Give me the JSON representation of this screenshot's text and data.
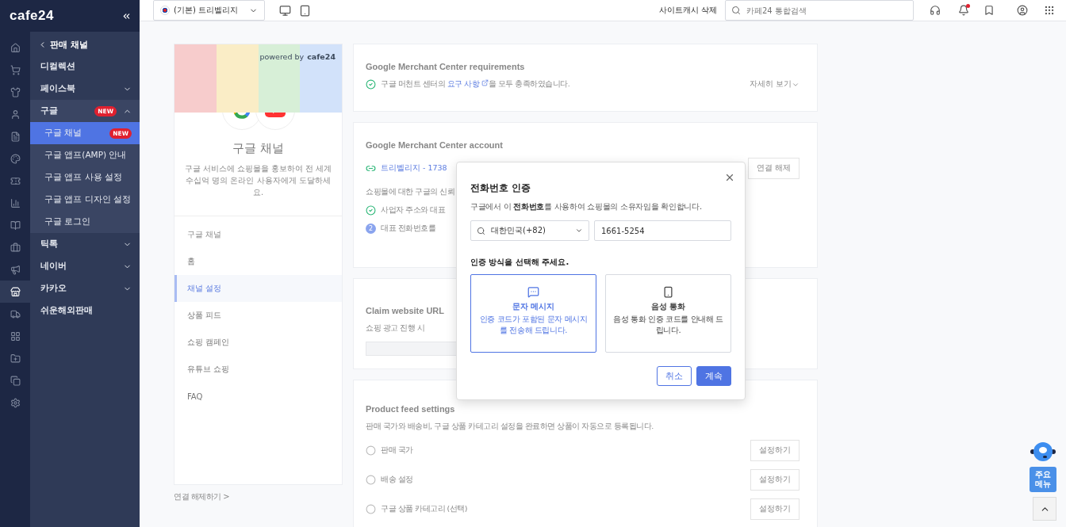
{
  "logo": "cafe24",
  "rail": [
    {
      "selected": false
    },
    {
      "selected": false
    },
    {
      "selected": false
    },
    {
      "selected": false
    },
    {
      "selected": false
    },
    {
      "selected": false
    },
    {
      "selected": false
    },
    {
      "selected": false
    },
    {
      "selected": false
    },
    {
      "selected": false
    },
    {
      "selected": false
    },
    {
      "selected": true
    },
    {
      "selected": false
    },
    {
      "selected": false
    },
    {
      "selected": false
    },
    {
      "selected": false
    },
    {
      "selected": false
    }
  ],
  "submenu": {
    "back": "판매 채널",
    "items": [
      {
        "label": "디컬렉션",
        "selected": false
      },
      {
        "label": "페이스북",
        "selected": false,
        "expanded": false
      },
      {
        "label": "구글",
        "badge": "NEW",
        "selected": false,
        "expanded": true,
        "children": [
          {
            "label": "구글 채널",
            "badge": "NEW",
            "selected": true
          },
          {
            "label": "구글 앱프(AMP) 안내",
            "selected": false
          },
          {
            "label": "구글 앱프 사용 설정",
            "selected": false
          },
          {
            "label": "구글 앱프 디자인 설정",
            "selected": false
          },
          {
            "label": "구글 로그인",
            "selected": false
          }
        ]
      },
      {
        "label": "틱톡",
        "selected": false,
        "expanded": false
      },
      {
        "label": "네이버",
        "selected": false,
        "expanded": false
      },
      {
        "label": "카카오",
        "selected": false,
        "expanded": false
      },
      {
        "label": "쉬운해외판매",
        "selected": false
      }
    ]
  },
  "topbar": {
    "shop": "(기본) 트리벨리지",
    "cache_button": "사이트캐시 삭제",
    "search": {
      "placeholder": "카페24 통합검색"
    },
    "notification_dot": true
  },
  "channel_card": {
    "powered_by": "powered by",
    "brand": "cafe24",
    "title": "구글 채널",
    "description": "구글 서비스에 쇼핑몰을 홍보하여 전 세계 수십억 명의 온라인 사용자에게 도달하세요.",
    "nav_header": "구글 채널",
    "nav": [
      {
        "label": "홈",
        "selected": false
      },
      {
        "label": "채널 설정",
        "selected": true
      },
      {
        "label": "상품 피드",
        "selected": false
      },
      {
        "label": "쇼핑 캠페인",
        "selected": false
      },
      {
        "label": "유튜브 쇼핑",
        "selected": false
      },
      {
        "label": "FAQ",
        "selected": false
      }
    ],
    "disconnect": "연결 해제하기 >"
  },
  "requirements": {
    "title": "Google Merchant Center requirements",
    "before": "구글 머천트 센터의",
    "link": "요구 사항",
    "after": "을 모두 충족하였습니다.",
    "more": "자세히 보기"
  },
  "account": {
    "title": "Google Merchant Center account",
    "account": "트리벨리지 - 1738",
    "disconnect": "연결 해제",
    "trust": "쇼핑몰에 대한 구글의 신뢰",
    "steps": [
      {
        "label": "사업자 주소와 대표",
        "done": true
      },
      {
        "label": "대표 전화번호를",
        "done": false,
        "number": "2"
      }
    ]
  },
  "claim": {
    "title": "Claim website URL",
    "description": "쇼핑 광고 진행 시"
  },
  "feed": {
    "title": "Product feed settings",
    "description": "판매 국가와 배송비, 구글 상품 카테고리 설정을 완료하면 상품이 자동으로 등록됩니다.",
    "rows": [
      {
        "label": "판매 국가",
        "action": "설정하기"
      },
      {
        "label": "배송 설정",
        "action": "설정하기"
      },
      {
        "label": "구글 상품 카테고리 (선택)",
        "action": "설정하기"
      }
    ]
  },
  "dialog": {
    "title": "전화번호 인증",
    "description": "구글에서 이 **전화번호**를 사용하여 쇼핑몰의 소유자임을 확인합니다.",
    "country": "대한민국(+82)",
    "phone": "1661-5254",
    "method_prompt": "인증 방식을 선택해 주세요.",
    "methods": [
      {
        "kind": "sms",
        "title": "문자 메시지",
        "description": "인증 코드가 포함된 문자 메시지를 전송해 드립니다.",
        "selected": true
      },
      {
        "kind": "voice",
        "title": "음성 통화",
        "description": "음성 통화 인증 코드를 안내해 드립니다.",
        "selected": false
      }
    ],
    "buttons": [
      {
        "label": "취소",
        "kind": "secondary"
      },
      {
        "label": "계속",
        "kind": "primary"
      }
    ]
  },
  "quick_menu": "주요\n메뉴"
}
